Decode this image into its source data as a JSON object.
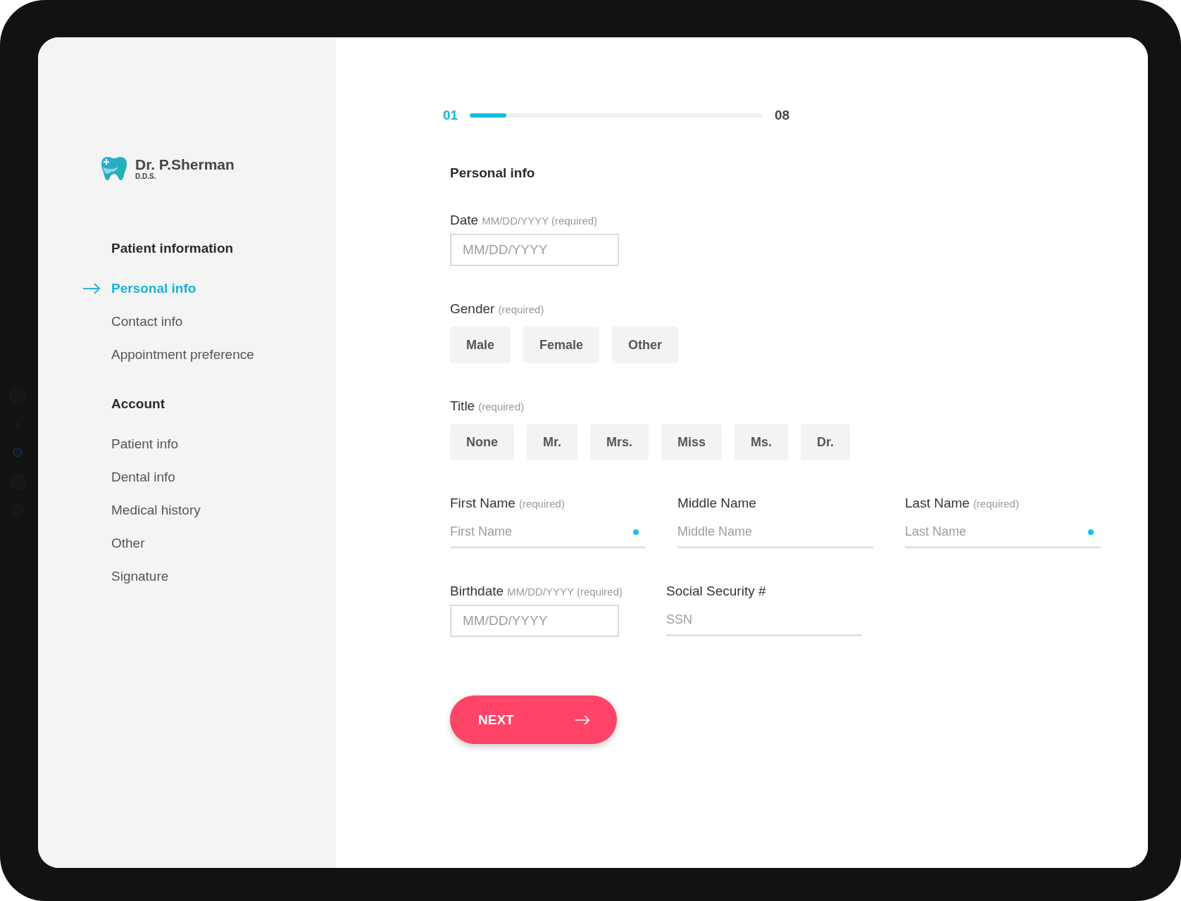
{
  "progress": {
    "current": "01",
    "total": "08",
    "level": 0.125
  },
  "sidebar": {
    "logo": {
      "name": "Dr. P.Sherman",
      "subtitle": "D.D.S."
    },
    "sections": [
      {
        "heading": "Patient information",
        "items": [
          {
            "label": "Personal info",
            "selected": true
          },
          {
            "label": "Contact info",
            "selected": false
          },
          {
            "label": "Appointment preference",
            "selected": false
          }
        ]
      },
      {
        "heading": "Account",
        "items": [
          {
            "label": "Patient info",
            "selected": false
          },
          {
            "label": "Dental info",
            "selected": false
          },
          {
            "label": "Medical history",
            "selected": false
          },
          {
            "label": "Other",
            "selected": false
          },
          {
            "label": "Signature",
            "selected": false
          }
        ]
      }
    ]
  },
  "form": {
    "heading": "Personal info",
    "rows": [
      [
        {
          "kind": "boxed",
          "label": "Date",
          "note": "MM/DD/YYYY (required)",
          "placeholder": "MM/DD/YYYY"
        }
      ],
      [
        {
          "kind": "choices",
          "label": "Gender",
          "note": "(required)",
          "options": [
            {
              "label": "Male",
              "selected": false
            },
            {
              "label": "Female",
              "selected": false
            },
            {
              "label": "Other",
              "selected": false
            }
          ]
        }
      ],
      [
        {
          "kind": "choices",
          "label": "Title",
          "note": "(required)",
          "options": [
            {
              "label": "None",
              "selected": false
            },
            {
              "label": "Mr.",
              "selected": false
            },
            {
              "label": "Mrs.",
              "selected": false
            },
            {
              "label": "Miss",
              "selected": false
            },
            {
              "label": "Ms.",
              "selected": false
            },
            {
              "label": "Dr.",
              "selected": false
            }
          ]
        }
      ],
      [
        {
          "kind": "underline",
          "label": "First Name",
          "note": "(required)",
          "placeholder": "First Name",
          "required": true
        },
        {
          "kind": "underline",
          "label": "Middle Name",
          "placeholder": "Middle Name",
          "required": false
        },
        {
          "kind": "underline",
          "label": "Last Name",
          "note": "(required)",
          "placeholder": "Last Name",
          "required": true
        }
      ],
      [
        {
          "kind": "boxed",
          "label": "Birthdate",
          "note": "MM/DD/YYYY (required)",
          "placeholder": "MM/DD/YYYY"
        },
        {
          "kind": "underline",
          "label": "Social Security #",
          "placeholder": "SSN",
          "required": false
        }
      ]
    ]
  },
  "next_button": {
    "label": "NEXT"
  }
}
